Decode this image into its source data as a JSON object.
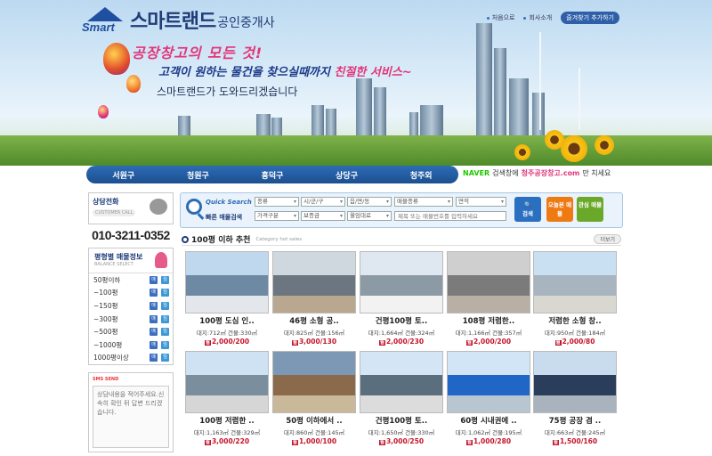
{
  "header": {
    "logo_word": "Smart",
    "logo_main": "스마트랜드",
    "logo_sub": "공인중개사",
    "toplinks": [
      "처음으로",
      "회사소개"
    ],
    "bookmark": "즐겨찾기 추가하기",
    "slogan1": "공장창고의 모든 것!",
    "slogan2_a": "고객이 원하는 물건을 찾으실때까지 ",
    "slogan2_b": "친절한 서비스~",
    "slogan3": "스마트랜드가 도와드리겠습니다"
  },
  "nav": {
    "items": [
      "서원구",
      "청원구",
      "흥덕구",
      "상당구",
      "청주외"
    ]
  },
  "naver": {
    "brand": "NAVER",
    "text_a": "검색창에",
    "keyword": "청주공장창고.com",
    "text_b": "만 치세요"
  },
  "sidebar": {
    "consult_title": "상담전화",
    "consult_sub": "CUSTOMER CALL",
    "phone": "010-3211-0352",
    "size_title": "평형별 매물정보",
    "size_sub": "BALANCE SELECT",
    "sizes": [
      "50평이하",
      "~100평",
      "~150평",
      "~300평",
      "~500평",
      "~1000평",
      "1000평이상"
    ],
    "btn_a": "매",
    "btn_b": "임",
    "sms_label": "SMS SEND",
    "sms_placeholder": "상담내용을 적어주세요.신속히 확인 뒤 답변 드리겠습니다."
  },
  "quick_search": {
    "title": "Quick Search",
    "subtitle": "빠른 매물검색",
    "row1": [
      "종류",
      "시/군/구",
      "읍/면/동",
      "매물종류",
      "면적"
    ],
    "row2": [
      "가격구분",
      "보증금",
      "월임대료"
    ],
    "keyword_placeholder": "제목 또는 매물번호를 입력하세요",
    "search_btn": "검색",
    "today_btn": "오늘본 매물",
    "interest_btn": "관심 매물"
  },
  "section": {
    "title": "100평 이하 추천",
    "subtitle": "Category hot sales",
    "more": "더보기"
  },
  "listings": [
    {
      "title": "100평 도심 인..",
      "land": "대지:712㎡",
      "bldg": "건물:330㎡",
      "tag": "월",
      "price": "2,000/200"
    },
    {
      "title": "46평 소형 공..",
      "land": "대지:825㎡",
      "bldg": "건물:156㎡",
      "tag": "월",
      "price": "3,000/130"
    },
    {
      "title": "건평100평 토..",
      "land": "대지:1,664㎡",
      "bldg": "건물:324㎡",
      "tag": "월",
      "price": "2,000/230"
    },
    {
      "title": "108평 저렴한..",
      "land": "대지:1,166㎡",
      "bldg": "건물:357㎡",
      "tag": "월",
      "price": "2,000/200"
    },
    {
      "title": "저렴한 소형 창..",
      "land": "대지:950㎡",
      "bldg": "건물:184㎡",
      "tag": "월",
      "price": "2,000/80"
    },
    {
      "title": "100평 저렴한 ..",
      "land": "대지:1,163㎡",
      "bldg": "건물:329㎡",
      "tag": "월",
      "price": "3,000/220"
    },
    {
      "title": "50평 이하에서 ..",
      "land": "대지:860㎡",
      "bldg": "건물:145㎡",
      "tag": "월",
      "price": "1,000/100"
    },
    {
      "title": "건평100평 토..",
      "land": "대지:1,650㎡",
      "bldg": "건물:330㎡",
      "tag": "월",
      "price": "3,000/250"
    },
    {
      "title": "60평 시내권에 ..",
      "land": "대지:1,062㎡",
      "bldg": "건물:195㎡",
      "tag": "월",
      "price": "1,000/280"
    },
    {
      "title": "75평 공장 겸 ..",
      "land": "대지:663㎡",
      "bldg": "건물:245㎡",
      "tag": "월",
      "price": "1,500/160"
    }
  ]
}
